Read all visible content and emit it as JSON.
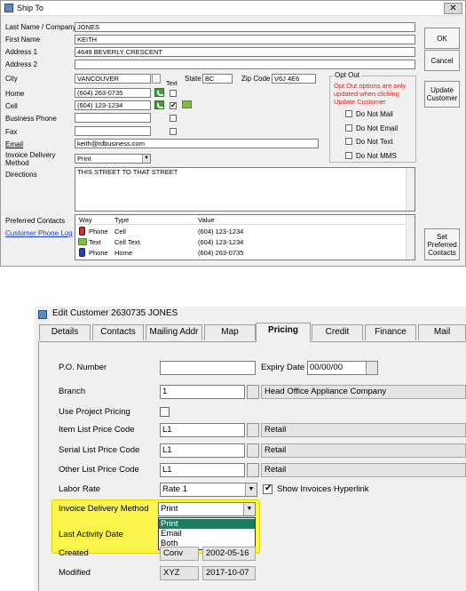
{
  "ship_to": {
    "title": "Ship To",
    "close": "✕",
    "labels": {
      "last_name": "Last Name / Company",
      "first_name": "First Name",
      "address1": "Address 1",
      "address2": "Address 2",
      "city": "City",
      "state": "State",
      "zip": "Zip Code",
      "home": "Home",
      "cell": "Cell",
      "business_phone": "Business Phone",
      "fax": "Fax",
      "email": "Email",
      "invoice_delivery": "Invoice Delivery Method",
      "directions": "Directions",
      "preferred_contacts": "Preferred Contacts",
      "customer_phone_log": "Customer Phone Log",
      "text_col": "Text"
    },
    "values": {
      "last_name": "JONES",
      "first_name": "KEITH",
      "address1": "4649 BEVERLY CRESCENT",
      "address2": "",
      "city": "VANCOUVER",
      "state": "BC",
      "zip": "V6J 4E6",
      "home": "(604) 263-0735",
      "cell": "(604) 123-1234",
      "business_phone": "",
      "fax": "",
      "email": "keith@rdbusiness.com",
      "invoice_delivery": "Print",
      "directions": "THIS STREET TO THAT STREET"
    },
    "opt_out": {
      "legend": "Opt Out",
      "notice": "Opt Out options are only updated when clicking Update Customer",
      "options": [
        "Do Not Mail",
        "Do Not Email",
        "Do Not Text",
        "Do Not MMS"
      ]
    },
    "buttons": {
      "ok": "OK",
      "cancel": "Cancel",
      "update_customer": "Update Customer",
      "set_preferred": "Set Preferred Contacts"
    },
    "contacts_table": {
      "headers": [
        "Way",
        "Type",
        "Value"
      ],
      "rows": [
        {
          "way": "Phone",
          "type": "Cell",
          "value": "(604) 123-1234"
        },
        {
          "way": "Text",
          "type": "Cell Text",
          "value": "(604) 123-1234"
        },
        {
          "way": "Phone",
          "type": "Home",
          "value": "(604) 263-0735"
        }
      ]
    }
  },
  "edit_customer": {
    "title": "Edit Customer 2630735 JONES",
    "tabs": [
      "Details",
      "Contacts",
      "Mailing Addr",
      "Map",
      "Pricing",
      "Credit",
      "Finance",
      "Mail"
    ],
    "active_tab": "Pricing",
    "labels": {
      "po_number": "P.O. Number",
      "expiry_date": "Expiry Date",
      "branch": "Branch",
      "use_project_pricing": "Use Project Pricing",
      "item_list_price_code": "Item List Price Code",
      "serial_list_price_code": "Serial List Price Code",
      "other_list_price_code": "Other List Price Code",
      "labor_rate": "Labor Rate",
      "show_invoices_hyperlink": "Show Invoices Hyperlink",
      "invoice_delivery_method": "Invoice Delivery Method",
      "last_activity_date": "Last Activity Date",
      "created": "Created",
      "modified": "Modified"
    },
    "values": {
      "po_number": "",
      "expiry_date": "00/00/00",
      "branch": "1",
      "branch_name": "Head Office Appliance Company",
      "item_list_price_code": "L1",
      "item_list_price_name": "Retail",
      "serial_list_price_code": "L1",
      "serial_list_price_name": "Retail",
      "other_list_price_code": "L1",
      "other_list_price_name": "Retail",
      "labor_rate": "Rate 1",
      "invoice_delivery_method": "Print",
      "created_by": "Conv",
      "created_date": "2002-05-16",
      "modified_by": "XYZ",
      "modified_date": "2017-10-07"
    },
    "dropdown_options": [
      "Print",
      "Email",
      "Both"
    ],
    "highlight_color": "#faf54a",
    "selected_option_color": "#1e7b61"
  }
}
